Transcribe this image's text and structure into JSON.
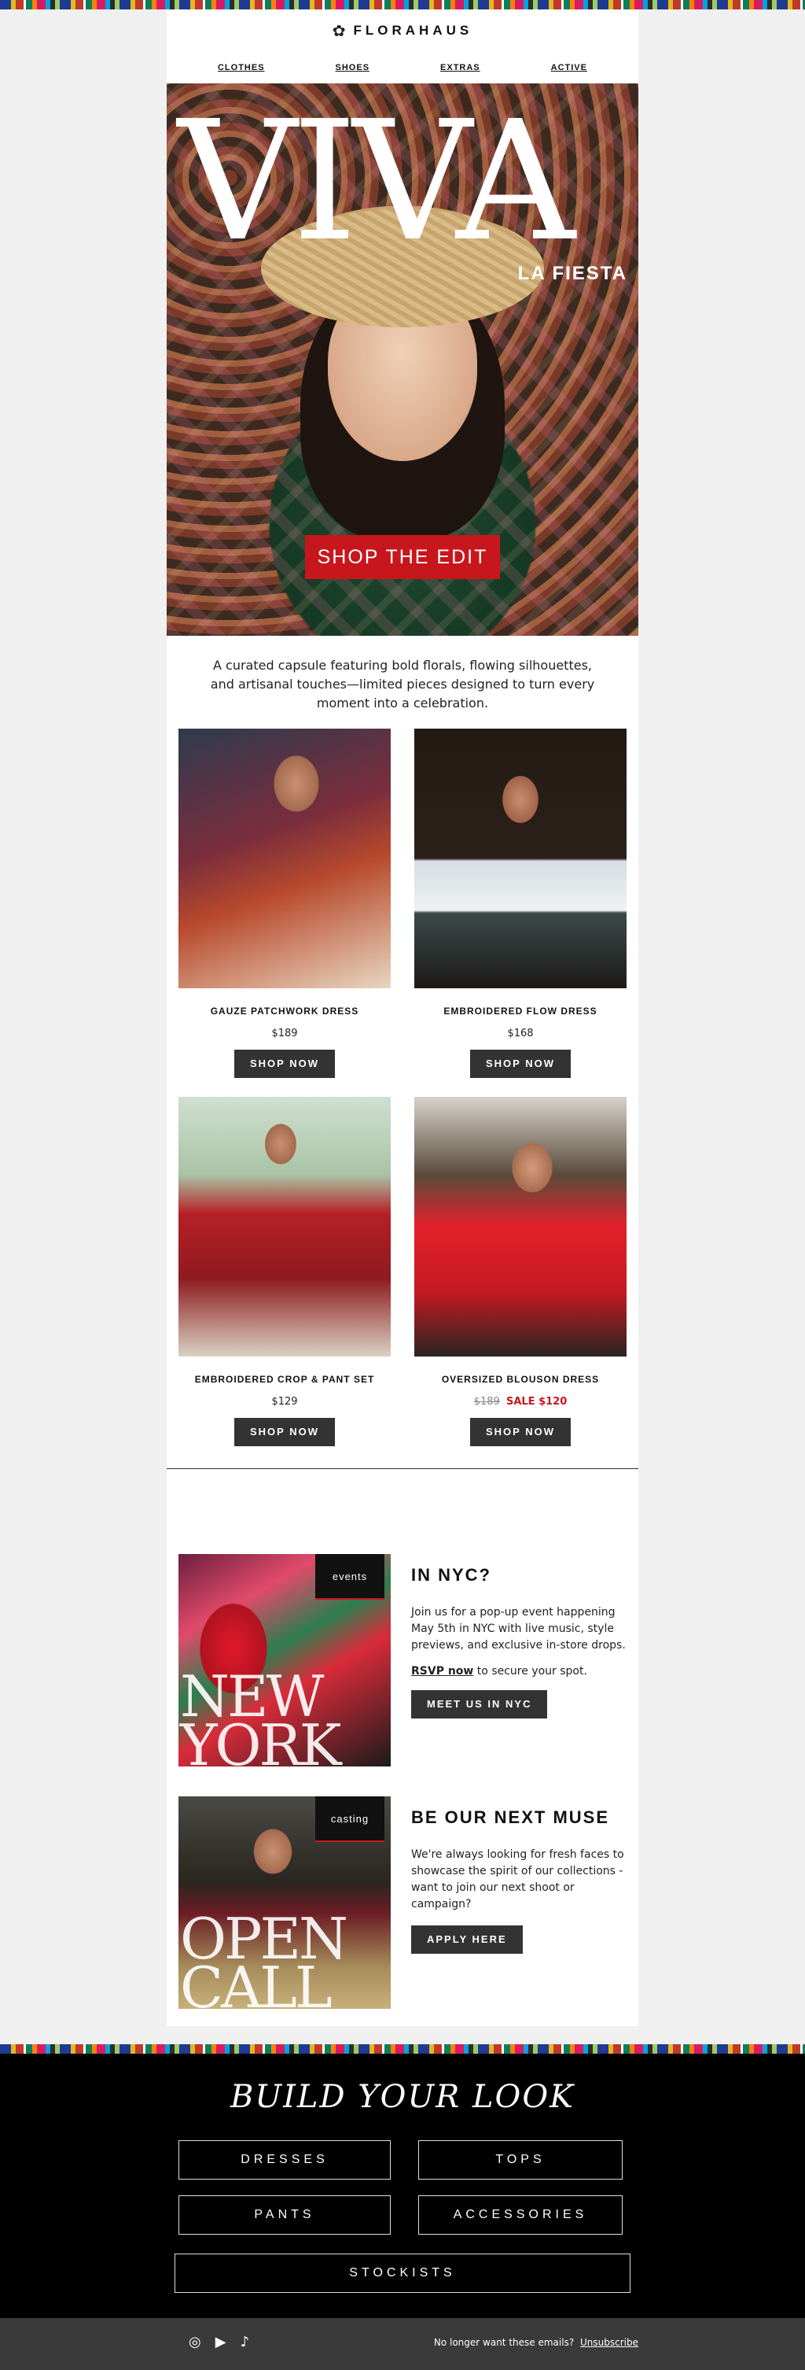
{
  "brand": {
    "logo_icon": "✿",
    "name": "FLORAHAUS"
  },
  "nav": [
    "CLOTHES",
    "SHOES",
    "EXTRAS",
    "ACTIVE"
  ],
  "hero": {
    "title": "VIVA",
    "subtitle": "LA FIESTA",
    "cta": "SHOP THE EDIT"
  },
  "intro": "A curated capsule featuring bold florals, flowing silhouettes, and artisanal touches—limited pieces designed to turn every moment into a celebration.",
  "products": [
    {
      "name": "GAUZE PATCHWORK DRESS",
      "price": "$189",
      "button": "SHOP NOW"
    },
    {
      "name": "EMBROIDERED FLOW DRESS",
      "price": "$168",
      "button": "SHOP NOW"
    },
    {
      "name": "EMBROIDERED CROP & PANT SET",
      "price": "$129",
      "button": "SHOP NOW"
    },
    {
      "name": "OVERSIZED BLOUSON DRESS",
      "price_old": "$189",
      "price_sale": "SALE $120",
      "button": "SHOP NOW"
    }
  ],
  "features": [
    {
      "tag": "events",
      "overlay_line1": "NEW",
      "overlay_line2": "YORK",
      "heading": "IN NYC?",
      "body": "Join us for a pop-up event happening May 5th in NYC with live music, style previews, and exclusive in-store drops.",
      "rsvp_link": "RSVP now",
      "rsvp_rest": " to secure your spot.",
      "button": "MEET US IN NYC"
    },
    {
      "tag": "casting",
      "overlay_line1": "OPEN",
      "overlay_line2": "CALL",
      "heading": "BE OUR NEXT MUSE",
      "body": "We're always looking for fresh faces to showcase the spirit of our collections - want to join our next shoot or campaign?",
      "button": "APPLY HERE"
    }
  ],
  "footer": {
    "heading": "BUILD YOUR LOOK",
    "buttons": [
      "DRESSES",
      "TOPS",
      "PANTS",
      "ACCESSORIES",
      "STOCKISTS"
    ],
    "social_icons": [
      "instagram-icon",
      "youtube-icon",
      "tiktok-icon"
    ],
    "unsubscribe_text": "No longer want these emails?",
    "unsubscribe_link": "Unsubscribe"
  },
  "colors": {
    "accent": "#c8161d",
    "dark_button": "#333333"
  }
}
